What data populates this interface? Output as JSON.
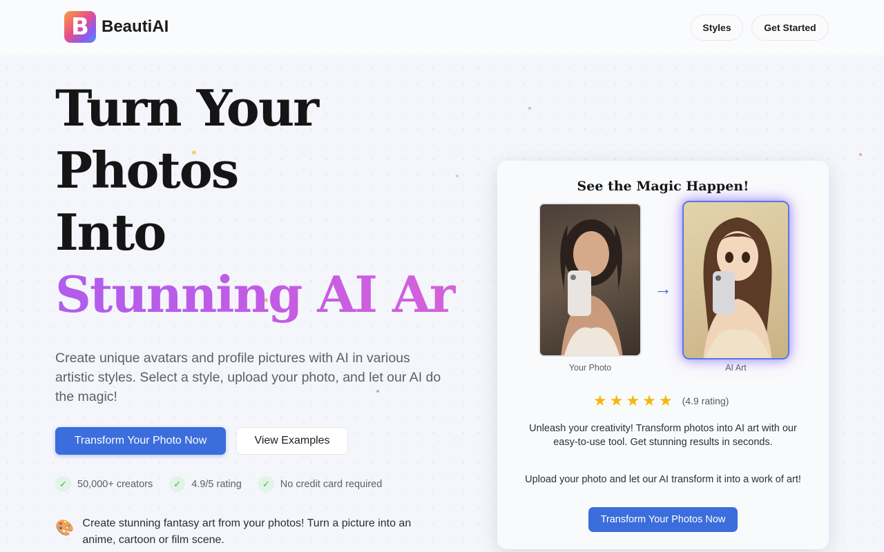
{
  "header": {
    "logo_letter": "B",
    "brand_name": "BeautiAI",
    "nav": {
      "styles_label": "Styles",
      "get_started_label": "Get Started"
    }
  },
  "hero": {
    "title_lines": [
      "Turn Your",
      "Photos",
      "Into",
      "Stunning AI Art"
    ],
    "description": "Create unique avatars and profile pictures with AI in various artistic styles. Select a style, upload your photo, and let our AI do the magic!",
    "primary_cta": "Transform Your Photo Now",
    "secondary_cta": "View Examples",
    "features": [
      "50,000+ creators",
      "4.9/5 rating",
      "No credit card required"
    ],
    "promo_text": "Create stunning fantasy art from your photos! Turn a picture into an anime, cartoon or film scene."
  },
  "card": {
    "title": "See the Magic Happen!",
    "photo_caption": "Your Photo",
    "ai_caption": "AI Art",
    "stars": 5,
    "rating_text": "(4.9 rating)",
    "paragraph1": "Unleash your creativity! Transform photos into AI art with our easy-to-use tool. Get stunning results in seconds.",
    "paragraph2": "Upload your photo and let our AI transform it into a work of art!",
    "cta": "Transform Your Photos Now"
  },
  "colors": {
    "accent": "#3b6ddc",
    "gradient_text": [
      "#b05ced",
      "#d462d9"
    ],
    "star": "#f6b70b",
    "check": "#3eae5d"
  }
}
